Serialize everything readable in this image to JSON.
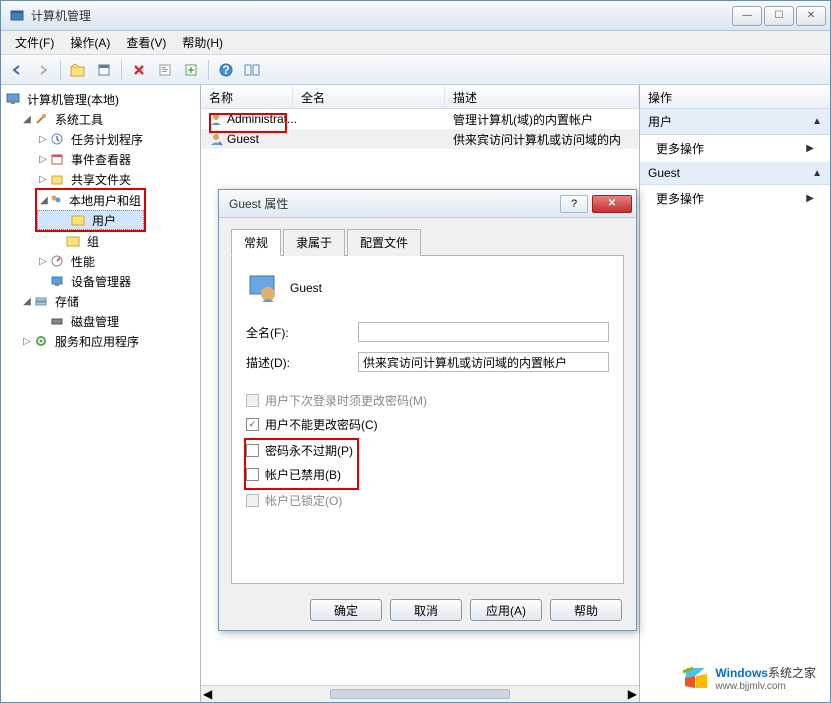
{
  "window": {
    "title": "计算机管理"
  },
  "menu": {
    "file": "文件(F)",
    "action": "操作(A)",
    "view": "查看(V)",
    "help": "帮助(H)"
  },
  "tree": {
    "root": "计算机管理(本地)",
    "systools": "系统工具",
    "task_sched": "任务计划程序",
    "event_viewer": "事件查看器",
    "shared": "共享文件夹",
    "local_users": "本地用户和组",
    "users": "用户",
    "groups": "组",
    "perf": "性能",
    "devmgr": "设备管理器",
    "storage": "存储",
    "diskmgmt": "磁盘管理",
    "services_apps": "服务和应用程序"
  },
  "list": {
    "col_name": "名称",
    "col_fullname": "全名",
    "col_desc": "描述",
    "rows": [
      {
        "name": "Administrat...",
        "fullname": "",
        "desc": "管理计算机(域)的内置帐户"
      },
      {
        "name": "Guest",
        "fullname": "",
        "desc": "供来宾访问计算机或访问域的内"
      }
    ]
  },
  "actions": {
    "header": "操作",
    "sec1": "用户",
    "more1": "更多操作",
    "sec2": "Guest",
    "more2": "更多操作"
  },
  "dialog": {
    "title": "Guest 属性",
    "tabs": {
      "general": "常规",
      "memberof": "隶属于",
      "profile": "配置文件"
    },
    "username": "Guest",
    "fullname_label": "全名(F):",
    "fullname_value": "",
    "desc_label": "描述(D):",
    "desc_value": "供来宾访问计算机或访问域的内置帐户",
    "cb_change_next_login": "用户下次登录时须更改密码(M)",
    "cb_cannot_change": "用户不能更改密码(C)",
    "cb_never_expires": "密码永不过期(P)",
    "cb_disabled": "帐户已禁用(B)",
    "cb_locked": "帐户已锁定(O)",
    "btn_ok": "确定",
    "btn_cancel": "取消",
    "btn_apply": "应用(A)",
    "btn_help": "帮助"
  },
  "watermark": {
    "brand": "Windows",
    "suffix": "系统之家",
    "url": "www.bjjmlv.com"
  }
}
